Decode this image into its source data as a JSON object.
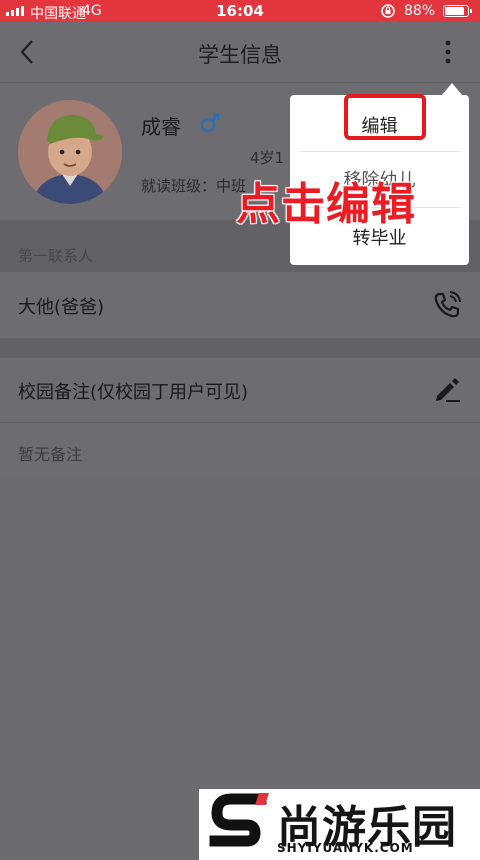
{
  "status_bar": {
    "carrier": "中国联通",
    "network": "4G",
    "time": "16:04",
    "battery": "88%",
    "battery_level": 0.88
  },
  "nav": {
    "title": "学生信息",
    "back_icon": "chevron-left-icon",
    "more_icon": "more-vertical-icon"
  },
  "student": {
    "name": "成睿",
    "gender_icon": "male-icon",
    "age_text": "4岁1",
    "class_text": "就读班级：中班"
  },
  "contacts": {
    "section_label": "第一联系人",
    "primary": "大他(爸爸)",
    "call_icon": "phone-call-icon"
  },
  "notes": {
    "title": "校园备注(仅校园丁用户可见)",
    "edit_icon": "pencil-icon",
    "empty_text": "暂无备注"
  },
  "menu": {
    "items": [
      "编辑",
      "移除幼儿",
      "转毕业"
    ]
  },
  "annotation": "点击编辑",
  "watermark": {
    "brand": "尚游乐园",
    "url": "SHYIYUANYK.COM"
  },
  "colors": {
    "status_bar": "#e3353e",
    "overlay_bg": "#6d6c71",
    "highlight": "#e5191b"
  }
}
